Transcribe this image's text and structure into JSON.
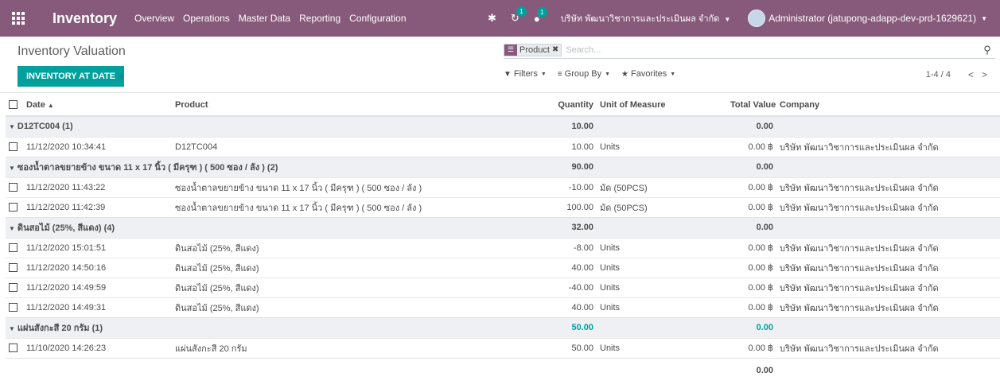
{
  "navbar": {
    "brand": "Inventory",
    "menu": [
      "Overview",
      "Operations",
      "Master Data",
      "Reporting",
      "Configuration"
    ],
    "activity_badge": "1",
    "messages_badge": "1",
    "company": "บริษัท พัฒนาวิชาการและประเมินผล จำกัด",
    "user": "Administrator (jatupong-adapp-dev-prd-1629621)",
    "accent_color": "#875a7b"
  },
  "control_panel": {
    "breadcrumb": "Inventory Valuation",
    "search": {
      "facet_label": "Product",
      "placeholder": "Search..."
    },
    "primary_button": "INVENTORY AT DATE",
    "filters_label": "Filters",
    "group_by_label": "Group By",
    "favorites_label": "Favorites",
    "pager": "1-4 / 4",
    "button_color": "#00a09d"
  },
  "table": {
    "headers": {
      "date": "Date",
      "product": "Product",
      "quantity": "Quantity",
      "uom": "Unit of Measure",
      "total_value": "Total Value",
      "company": "Company"
    },
    "groups": [
      {
        "label": "D12TC004 (1)",
        "quantity": "10.00",
        "total_value": "0.00",
        "rows": [
          {
            "date": "11/12/2020 10:34:41",
            "product": "D12TC004",
            "quantity": "10.00",
            "uom": "Units",
            "total_value": "0.00 ฿",
            "company": "บริษัท พัฒนาวิชาการและประเมินผล จำกัด"
          }
        ]
      },
      {
        "label": "ซองน้ำตาลขยายข้าง ขนาด 11 x 17 นิ้ว ( มีครุฑ ) ( 500 ซอง / ลัง ) (2)",
        "quantity": "90.00",
        "total_value": "0.00",
        "rows": [
          {
            "date": "11/12/2020 11:43:22",
            "product": "ซองน้ำตาลขยายข้าง ขนาด 11 x 17 นิ้ว ( มีครุฑ ) ( 500 ซอง / ลัง )",
            "quantity": "-10.00",
            "uom": "มัด (50PCS)",
            "total_value": "0.00 ฿",
            "company": "บริษัท พัฒนาวิชาการและประเมินผล จำกัด"
          },
          {
            "date": "11/12/2020 11:42:39",
            "product": "ซองน้ำตาลขยายข้าง ขนาด 11 x 17 นิ้ว ( มีครุฑ ) ( 500 ซอง / ลัง )",
            "quantity": "100.00",
            "uom": "มัด (50PCS)",
            "total_value": "0.00 ฿",
            "company": "บริษัท พัฒนาวิชาการและประเมินผล จำกัด"
          }
        ]
      },
      {
        "label": "ดินสอไม้ (25%, สีแดง) (4)",
        "quantity": "32.00",
        "total_value": "0.00",
        "rows": [
          {
            "date": "11/12/2020 15:01:51",
            "product": "ดินสอไม้ (25%, สีแดง)",
            "quantity": "-8.00",
            "uom": "Units",
            "total_value": "0.00 ฿",
            "company": "บริษัท พัฒนาวิชาการและประเมินผล จำกัด"
          },
          {
            "date": "11/12/2020 14:50:16",
            "product": "ดินสอไม้ (25%, สีแดง)",
            "quantity": "40.00",
            "uom": "Units",
            "total_value": "0.00 ฿",
            "company": "บริษัท พัฒนาวิชาการและประเมินผล จำกัด"
          },
          {
            "date": "11/12/2020 14:49:59",
            "product": "ดินสอไม้ (25%, สีแดง)",
            "quantity": "-40.00",
            "uom": "Units",
            "total_value": "0.00 ฿",
            "company": "บริษัท พัฒนาวิชาการและประเมินผล จำกัด"
          },
          {
            "date": "11/12/2020 14:49:31",
            "product": "ดินสอไม้ (25%, สีแดง)",
            "quantity": "40.00",
            "uom": "Units",
            "total_value": "0.00 ฿",
            "company": "บริษัท พัฒนาวิชาการและประเมินผล จำกัด"
          }
        ]
      },
      {
        "label": "แผ่นสังกะสี 20 กรัม (1)",
        "quantity": "50.00",
        "total_value": "0.00",
        "rows": [
          {
            "date": "11/10/2020 14:26:23",
            "product": "แผ่นสังกะสี 20 กรัม",
            "quantity": "50.00",
            "uom": "Units",
            "total_value": "0.00 ฿",
            "company": "บริษัท พัฒนาวิชาการและประเมินผล จำกัด"
          }
        ]
      }
    ],
    "footer_total": "0.00"
  }
}
